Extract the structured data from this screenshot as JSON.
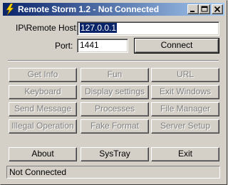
{
  "window": {
    "title": "Remote Storm 1.2 - Not Connected",
    "icon": "lightning-icon",
    "controls": [
      "minimize-icon",
      "maximize-icon",
      "close-icon"
    ]
  },
  "connection": {
    "host_label": "IP\\Remote Host:",
    "host_value": "127.0.0.1",
    "port_label": "Port:",
    "port_value": "1441",
    "connect_label": "Connect"
  },
  "actions": [
    [
      "Get Info",
      "Fun",
      "URL"
    ],
    [
      "Keyboard",
      "Display settings",
      "Exit Windows"
    ],
    [
      "Send Message",
      "Processes",
      "File Manager"
    ],
    [
      "Illegal Operation",
      "Fake Format",
      "Server Setup"
    ]
  ],
  "bottom": {
    "about_label": "About",
    "systray_label": "SysTray",
    "exit_label": "Exit"
  },
  "status": "Not Connected",
  "colors": {
    "titlebar_start": "#0a246a",
    "titlebar_end": "#a6caf0",
    "face": "#d4d0c8",
    "disabled_text": "#808080",
    "selection": "#0a246a"
  }
}
